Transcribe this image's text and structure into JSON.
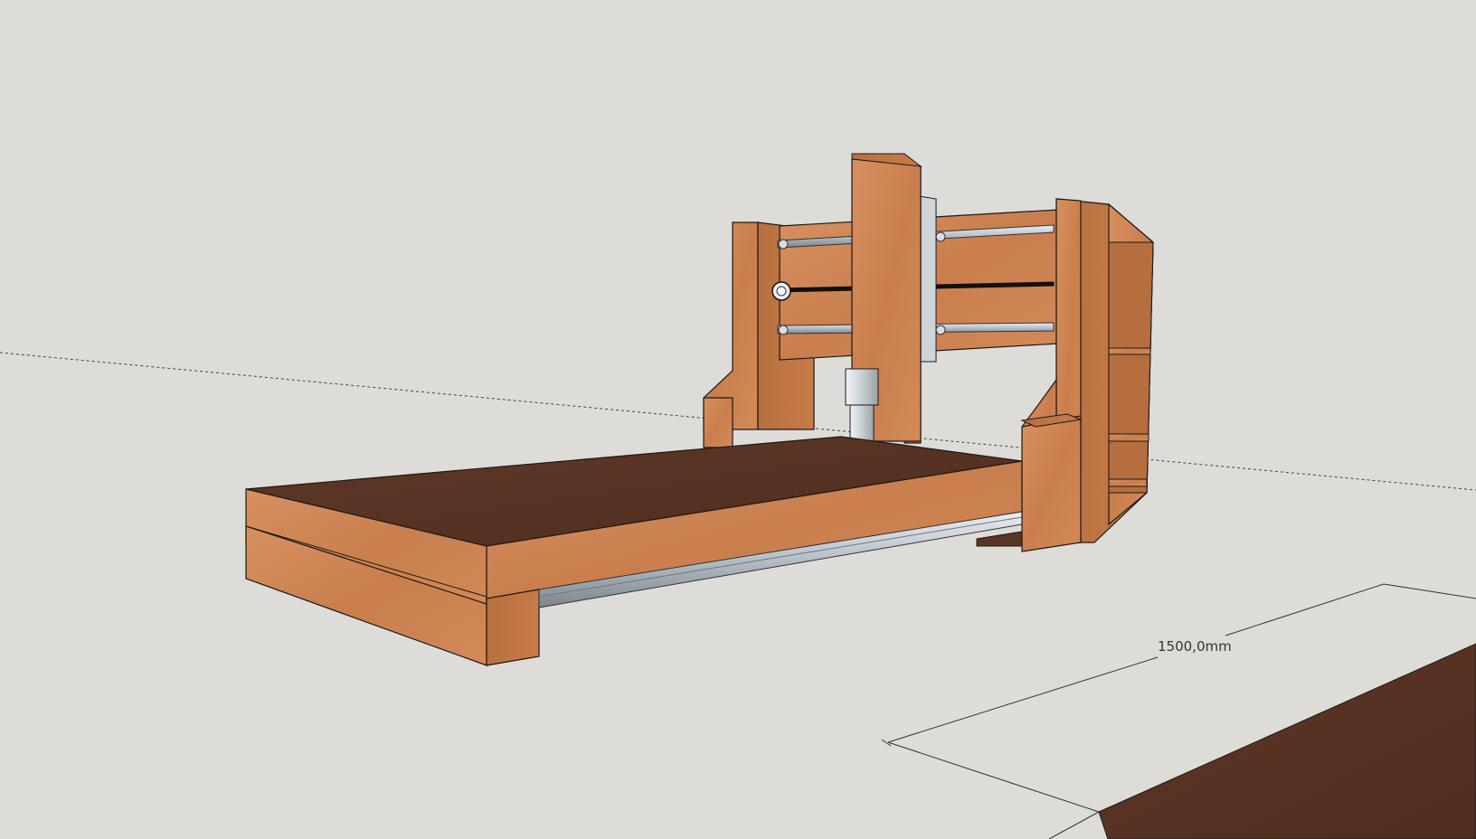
{
  "viewport": {
    "dimension_label": "1500,0mm"
  },
  "colors": {
    "background": "#dddcd8",
    "wood_face": "#cc8452",
    "wood_side": "#b7703f",
    "wood_top": "#5b3524",
    "rail": "#bcc4cb",
    "rail_dark": "#7d858c",
    "outline": "#1a1a1a",
    "axis_line": "#333333"
  },
  "icons": {
    "model": "cnc-router-model"
  }
}
